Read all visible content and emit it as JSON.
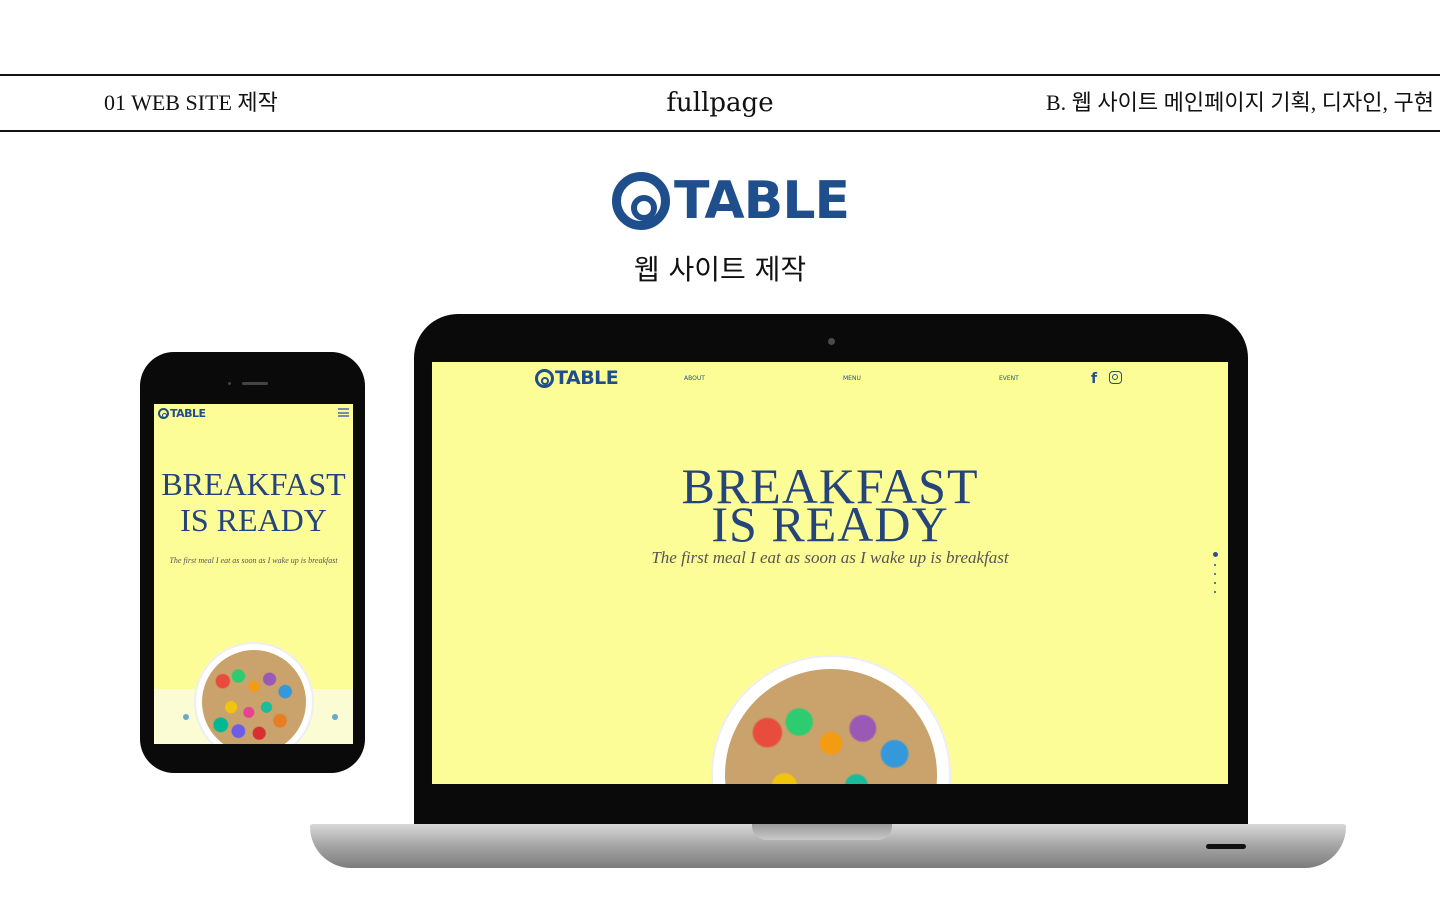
{
  "header": {
    "left": "01 WEB SITE 제작",
    "center": "fullpage",
    "right": "B. 웹 사이트 메인페이지 기획, 디자인, 구현"
  },
  "brand": {
    "name": "TABLE",
    "color": "#1f4e8c"
  },
  "subtitle": "웹 사이트 제작",
  "laptop": {
    "nav": {
      "about": "ABOUT",
      "menu": "MENU",
      "event": "EVENT"
    },
    "social": {
      "facebook": "f",
      "instagram": "instagram-icon"
    },
    "headline_line1": "BREAKFAST",
    "headline_line2": "IS READY",
    "tagline": "The first meal I eat as soon as I wake up is breakfast",
    "screen_bg": "#fdfd97"
  },
  "phone": {
    "headline_line1": "BREAKFAST",
    "headline_line2": "IS READY",
    "tagline": "The first meal I eat as soon as I wake up is breakfast"
  }
}
